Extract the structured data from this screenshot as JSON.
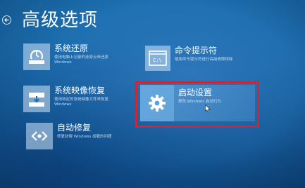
{
  "header": {
    "title": "高级选项",
    "back_icon": "back-arrow-icon"
  },
  "options": {
    "system_restore": {
      "title": "系统还原",
      "description": [
        "使用电脑上记录的还原点来还原",
        "Windows"
      ],
      "icon": "restore-icon"
    },
    "system_image": {
      "title": "系统映像恢复",
      "description": [
        "使用特定的系统映像文件来恢复",
        "Windows"
      ],
      "icon": "image-recovery-icon"
    },
    "auto_repair": {
      "title": "自动修复",
      "description": [
        "修复妨碍 Windows 加载的问题"
      ],
      "icon": "repair-icon"
    },
    "command_prompt": {
      "title": "命令提示符",
      "description": [
        "使用命令提示符进行高级故障排除"
      ],
      "icon": "command-prompt-icon",
      "icon_text": "C:\\"
    },
    "startup_settings": {
      "title": "启动设置",
      "description": [
        "更改 Windows 启动行为"
      ],
      "icon": "gear-icon",
      "highlighted": true
    }
  },
  "colors": {
    "background": "#1a68a8",
    "highlight_border": "#c62a3a",
    "tile_icon_bg": "#a9c8e6"
  }
}
